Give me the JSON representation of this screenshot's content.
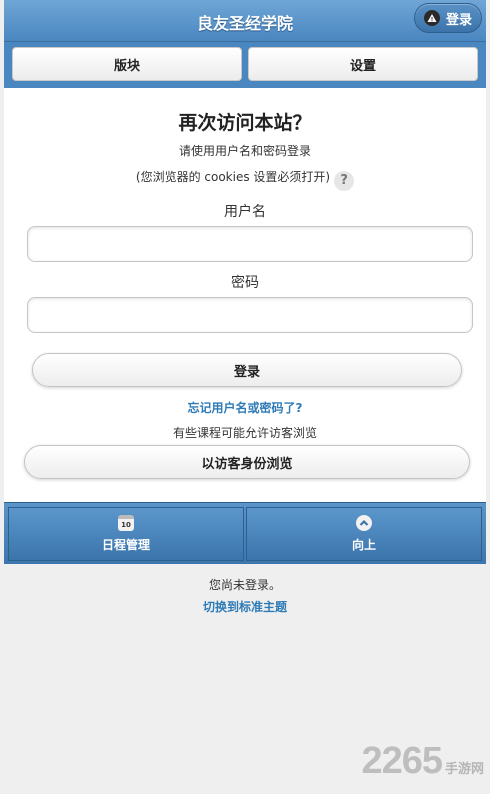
{
  "header": {
    "title": "良友圣经学院",
    "login_label": "登录",
    "login_icon": "warning-icon"
  },
  "navbar": {
    "blocks_label": "版块",
    "settings_label": "设置"
  },
  "login": {
    "heading": "再次访问本站？",
    "instruction": "请使用用户名和密码登录",
    "cookies_note": "(您浏览器的 cookies 设置必须打开)",
    "help_icon_glyph": "?",
    "username_label": "用户名",
    "username_value": "",
    "password_label": "密码",
    "password_value": "",
    "submit_label": "登录",
    "forgot_link": "忘记用户名或密码了?",
    "guest_note": "有些课程可能允许访客浏览",
    "guest_button": "以访客身份浏览"
  },
  "footer_nav": {
    "calendar_label": "日程管理",
    "calendar_icon_day": "10",
    "up_label": "向上"
  },
  "footer": {
    "status": "您尚未登录。",
    "switch_theme_link": "切换到标准主题"
  },
  "watermark": {
    "number": "2265",
    "suffix": "手游网"
  },
  "colors": {
    "header_blue": "#4a86c0",
    "link_blue": "#2f7bb6"
  }
}
